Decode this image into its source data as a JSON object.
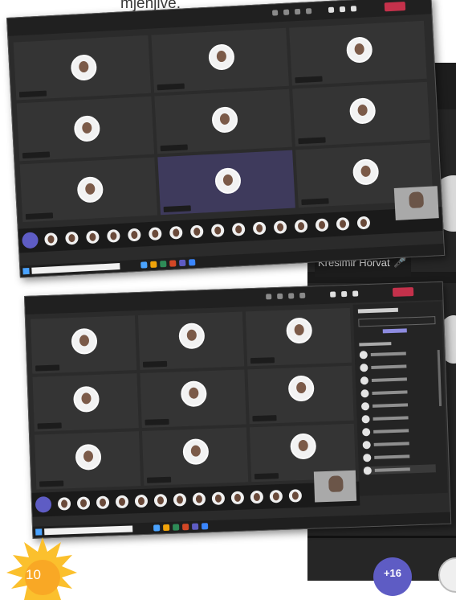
{
  "caption_text": "mjenjive.",
  "page_number": "10",
  "background_window": {
    "name_tag": "Kresimir Horvat",
    "more_participants": "+16"
  },
  "colors": {
    "teams_purple": "#5e5cc4",
    "leave_red": "#c4314b",
    "dark_bg": "#2b2b2b",
    "sun_yellow": "#fbc02d"
  }
}
